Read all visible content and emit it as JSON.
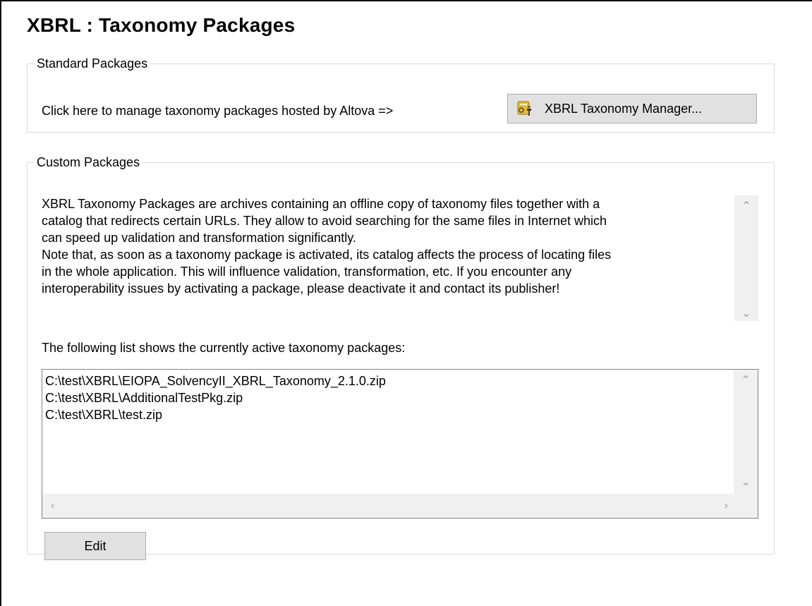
{
  "page": {
    "title": "XBRL : Taxonomy Packages"
  },
  "standard_packages": {
    "legend": "Standard Packages",
    "text": "Click here to manage taxonomy packages hosted by Altova =>",
    "button_label": "XBRL Taxonomy Manager...",
    "button_icon": "taxonomy-manager-icon"
  },
  "custom_packages": {
    "legend": "Custom Packages",
    "description": "XBRL Taxonomy Packages are archives containing an offline copy of taxonomy files together with a\ncatalog that redirects certain URLs. They allow to avoid searching for the same files in Internet which\ncan speed up validation and transformation significantly.\nNote that, as soon as a taxonomy package is activated, its catalog affects the process of locating files\nin the whole application. This will influence validation, transformation, etc. If you encounter any\ninteroperability issues by activating a package, please deactivate it and contact its publisher!",
    "list_label": "The following list shows the currently active taxonomy packages:",
    "packages": [
      "C:\\test\\XBRL\\EIOPA_SolvencyII_XBRL_Taxonomy_2.1.0.zip",
      "C:\\test\\XBRL\\AdditionalTestPkg.zip",
      "C:\\test\\XBRL\\test.zip"
    ],
    "edit_label": "Edit"
  },
  "colors": {
    "button_bg": "#e1e1e1",
    "button_border": "#adadad",
    "scrollbar_bg": "#f0f0f0",
    "group_border": "#dcdcdc"
  }
}
